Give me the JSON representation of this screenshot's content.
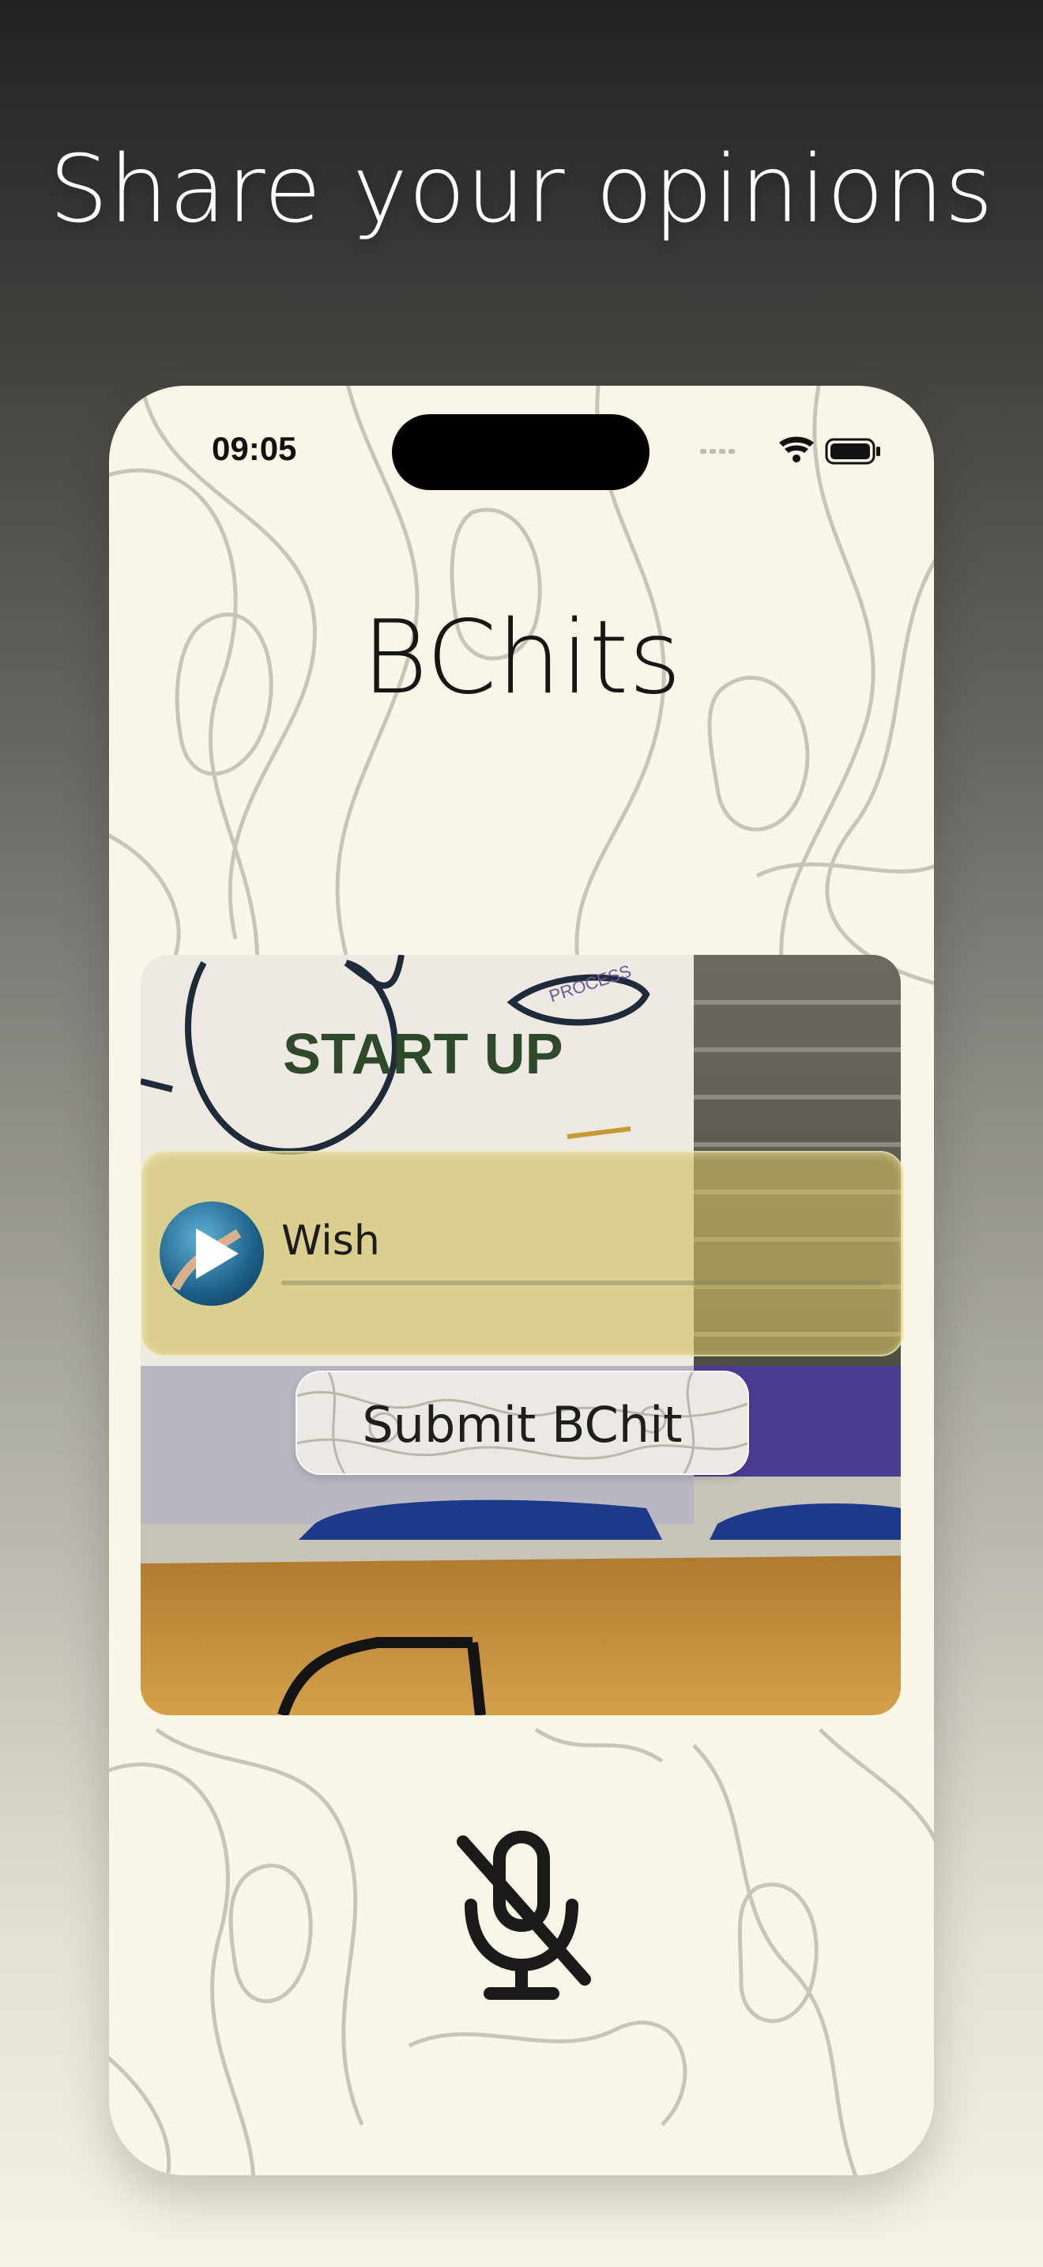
{
  "headline": "Share your opinions",
  "status": {
    "time": "09:05"
  },
  "app": {
    "title": "BChits"
  },
  "player": {
    "label": "Wish",
    "progress_fraction": 0.0
  },
  "actions": {
    "submit_label": "Submit BChit"
  },
  "mic": {
    "state": "muted",
    "icon": "mic-off-icon"
  },
  "scene_text": {
    "board_main": "START UP",
    "board_note": "PROCESS"
  },
  "colors": {
    "background": "#f9f5e7",
    "wish_bar": "#cebe5c",
    "text": "#161616"
  }
}
